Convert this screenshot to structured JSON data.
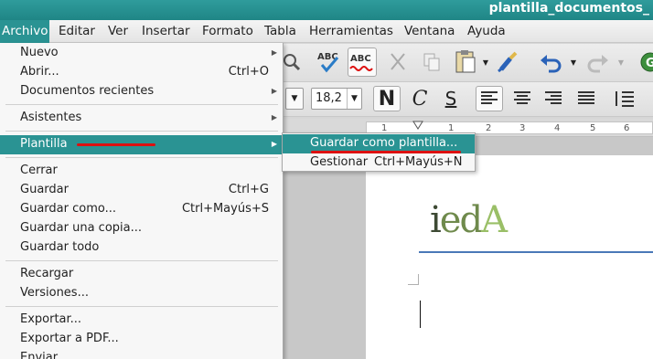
{
  "window": {
    "title": "plantilla_documentos_"
  },
  "menubar": {
    "items": [
      "Archivo",
      "Editar",
      "Ver",
      "Insertar",
      "Formato",
      "Tabla",
      "Herramientas",
      "Ventana",
      "Ayuda"
    ],
    "active": "Archivo"
  },
  "file_menu": {
    "items": [
      {
        "label": "Nuevo",
        "shortcut": "",
        "submenu": true
      },
      {
        "label": "Abrir...",
        "shortcut": "Ctrl+O",
        "submenu": false
      },
      {
        "label": "Documentos recientes",
        "shortcut": "",
        "submenu": true
      },
      {
        "label": "Asistentes",
        "shortcut": "",
        "submenu": true
      },
      {
        "label": "Plantilla",
        "shortcut": "",
        "submenu": true,
        "highlighted": true
      },
      {
        "label": "Cerrar",
        "shortcut": ""
      },
      {
        "label": "Guardar",
        "shortcut": "Ctrl+G"
      },
      {
        "label": "Guardar como...",
        "shortcut": "Ctrl+Mayús+S"
      },
      {
        "label": "Guardar una copia...",
        "shortcut": ""
      },
      {
        "label": "Guardar todo",
        "shortcut": ""
      },
      {
        "label": "Recargar",
        "shortcut": ""
      },
      {
        "label": "Versiones...",
        "shortcut": ""
      },
      {
        "label": "Exportar...",
        "shortcut": ""
      },
      {
        "label": "Exportar a PDF...",
        "shortcut": ""
      },
      {
        "label": "Enviar",
        "shortcut": ""
      }
    ]
  },
  "template_submenu": {
    "items": [
      {
        "label": "Guardar como plantilla...",
        "shortcut": "",
        "highlighted": true
      },
      {
        "label": "Gestionar",
        "shortcut": "Ctrl+Mayús+N"
      }
    ]
  },
  "toolbar": {
    "font_size": "18,2",
    "bold": "N",
    "italic": "C",
    "underline": "S",
    "spellcheck_label": "ABC"
  },
  "ruler": {
    "numbers": [
      "1",
      "1",
      "2",
      "3",
      "4",
      "5",
      "6"
    ]
  },
  "document": {
    "logo_text": "ieda"
  },
  "colors": {
    "accent": "#2a9393",
    "annotation": "#dd1111",
    "logo_rule": "#4a78b8"
  }
}
